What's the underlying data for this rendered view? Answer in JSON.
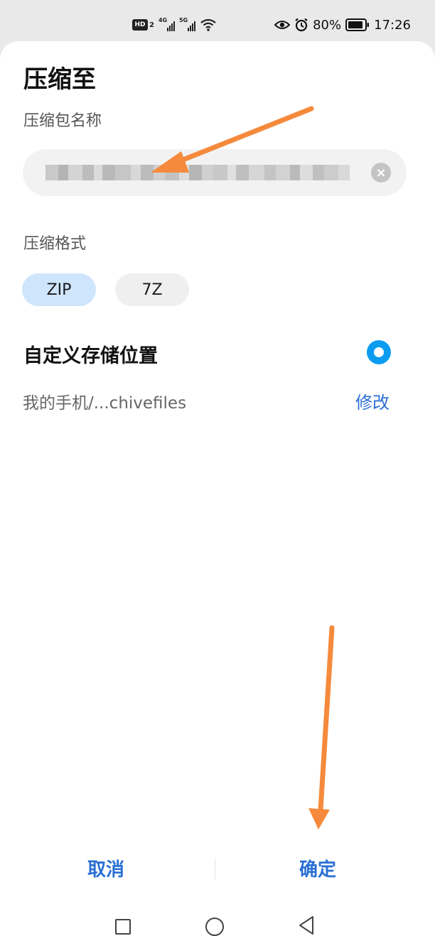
{
  "status_bar": {
    "hd_label": "HD",
    "hd_sub": "2",
    "net1": "4G",
    "net2": "5G",
    "battery": "80%",
    "time": "17:26",
    "icons": [
      "eye-icon",
      "alarm-icon",
      "battery-icon",
      "wifi-icon"
    ]
  },
  "dialog": {
    "title": "压缩至",
    "name_label": "压缩包名称",
    "format_label": "压缩格式",
    "formats": [
      "ZIP",
      "7Z"
    ],
    "selected_format": "ZIP",
    "custom_location_label": "自定义存储位置",
    "path": "我的手机/...chivefiles",
    "modify": "修改",
    "cancel": "取消",
    "confirm": "确定"
  },
  "colors": {
    "accent": "#2a6fd4",
    "toggle": "#0b9cf0",
    "selected_chip": "#cfe5fb",
    "annotation_arrow": "#f58a3c"
  }
}
